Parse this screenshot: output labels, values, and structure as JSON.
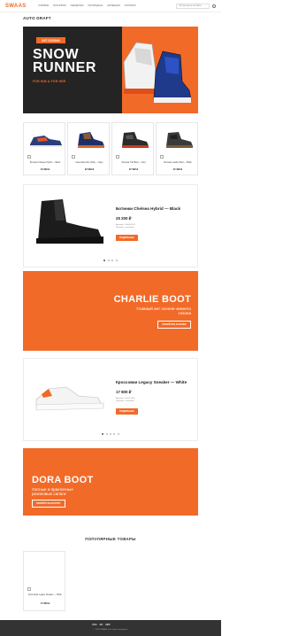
{
  "header": {
    "logo": "SWAAS",
    "nav": [
      "Новинки",
      "Мужчинам",
      "Женщинам",
      "Распродажа",
      "Коллекции",
      "Контакты"
    ],
    "search_placeholder": "Что вы ищете на сайте..."
  },
  "page": {
    "title": "AUTO DRAFT"
  },
  "hero": {
    "tag": "ХИТ СЕЗОНА",
    "title": "SNOW RUNNER",
    "subtitle": "FOR HIM & FOR HER",
    "colors": {
      "dark": "#242424",
      "accent": "#f26a28"
    }
  },
  "products": [
    {
      "name": "Ботинки Chelsea Hybrid — Black",
      "price": "24 990 ₽"
    },
    {
      "name": "Кроссовки Run Utility — Navy",
      "price": "22 990 ₽"
    },
    {
      "name": "Ботинки Trail Boot — Red",
      "price": "27 990 ₽"
    },
    {
      "name": "Ботинки Leather Boot — Black",
      "price": "21 990 ₽"
    }
  ],
  "slide1": {
    "name": "Ботинки Chelsea Hybrid — Black",
    "price": "25 200 ₽",
    "meta": [
      "Артикул: CH-HB-1001",
      "Наличие: в наличии"
    ],
    "button": "ПОДРОБНЕЕ"
  },
  "promo1": {
    "title": "CHARLIE BOOT",
    "text": "Главный хит осенне-зимнего сезона",
    "button": "ПЕРЕЙТИ В КАТАЛОГ"
  },
  "slide2": {
    "name": "Кроссовки Legacy Sneaker — White",
    "price": "17 800 ₽",
    "meta": [
      "Артикул: LS-WT-2002",
      "Наличие: в наличии"
    ],
    "button": "ПОДРОБНЕЕ"
  },
  "promo2": {
    "title": "DORA BOOT",
    "text": "Уютные и практичные резиновые сапоги",
    "button": "ПЕРЕЙТИ В КАТАЛОГ"
  },
  "popular": {
    "title": "ПОПУЛЯРНЫЕ ТОВАРЫ",
    "item": {
      "name": "Кроссовки Legacy Sneaker — White",
      "price": "17 800 ₽"
    }
  },
  "footer": {
    "payments": [
      "VISA",
      "MC",
      "МИР"
    ],
    "copyright": "© 2024 SWAAS. Все права защищены"
  }
}
